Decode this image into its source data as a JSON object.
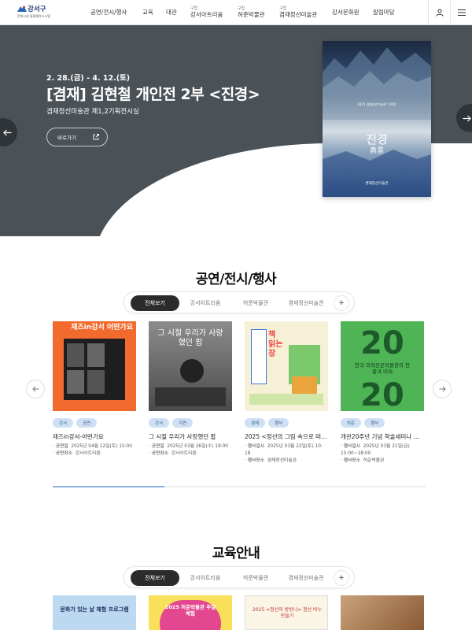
{
  "header": {
    "logo_title": "강서구",
    "logo_sub": "문화시설 통합예약시스템",
    "nav": [
      {
        "sup": "",
        "label": "공연/전시/행사"
      },
      {
        "sup": "",
        "label": "교육"
      },
      {
        "sup": "",
        "label": "대관"
      },
      {
        "sup": "구립",
        "label": "강서아트리움"
      },
      {
        "sup": "구립",
        "label": "허준박물관"
      },
      {
        "sup": "구립",
        "label": "겸재정선미술관"
      },
      {
        "sup": "",
        "label": "강서문화원"
      },
      {
        "sup": "",
        "label": "알림마당"
      }
    ],
    "icons": [
      "user-icon",
      "menu-icon"
    ]
  },
  "hero": {
    "dates": "2. 28.(금) - 4. 12.(토)",
    "title": "[겸재] 김현철 개인전 2부 <진경>",
    "venue": "겸재정선미술관 제1,2기획전시실",
    "button": "바로가기",
    "poster": {
      "title": "진경",
      "subtitle": "眞景",
      "small": "2025 겸재정선미술관 기획전",
      "org": "겸재정선미술관"
    }
  },
  "section1": {
    "title": "공연/전시/행사",
    "tabs": [
      "전체보기",
      "강서아트리움",
      "허준박물관",
      "겸재정선미술관"
    ],
    "active_tab": 0,
    "cards": [
      {
        "tags": [
          "강서",
          "공연"
        ],
        "title": "재즈in강서-어떤가요",
        "meta": [
          {
            "k": "공연일",
            "v": "2025년 04월 12일(토) 15:00"
          },
          {
            "k": "공연장소",
            "v": "강서아트리움"
          }
        ],
        "poster_text": "재즈in강서 어떤가요"
      },
      {
        "tags": [
          "강서",
          "지연"
        ],
        "title": "그 시절 우리가 사랑했던 팝",
        "meta": [
          {
            "k": "공연일",
            "v": "2025년 03월 26일(수) 19:00"
          },
          {
            "k": "공연장소",
            "v": "강서아트리움"
          }
        ],
        "poster_text": "그 시절 우리가 사랑했던 팝"
      },
      {
        "tags": [
          "겸재",
          "행사"
        ],
        "title": "2025 <정선의 그림 속으로 떠…",
        "meta": [
          {
            "k": "행사일시",
            "v": "2025년 03월 22일(토) 10-18"
          },
          {
            "k": "행사장소",
            "v": "겸재정선미술관"
          }
        ],
        "poster_text": "책 읽는 장"
      },
      {
        "tags": [
          "허준",
          "행사"
        ],
        "title": "개관20주년 기념 학술세미나 …",
        "meta": [
          {
            "k": "행사일시",
            "v": "2025년 03월 21일(금) 15:00~18:00"
          },
          {
            "k": "행사장소",
            "v": "허준박물관"
          }
        ],
        "poster_text": "한국 의학전문박물관의 현황과 미래"
      }
    ],
    "progress": 0.3
  },
  "section2": {
    "title": "교육안내",
    "tabs": [
      "전체보기",
      "강서아트리움",
      "허준박물관",
      "겸재정선미술관"
    ],
    "active_tab": 0,
    "cards": [
      {
        "text": "문화가 있는 날 체험 프로그램"
      },
      {
        "text": "2025 허준박물관 주말체험"
      },
      {
        "text": "2025 <정선의 방방니> 정선 바누 만들기"
      },
      {
        "text": ""
      }
    ]
  },
  "colors": {
    "hero_bg": "#4b5257",
    "tab_active": "#2b2b2b",
    "tag_bg": "#cfe0f6",
    "progress": "#8fb2e0"
  }
}
